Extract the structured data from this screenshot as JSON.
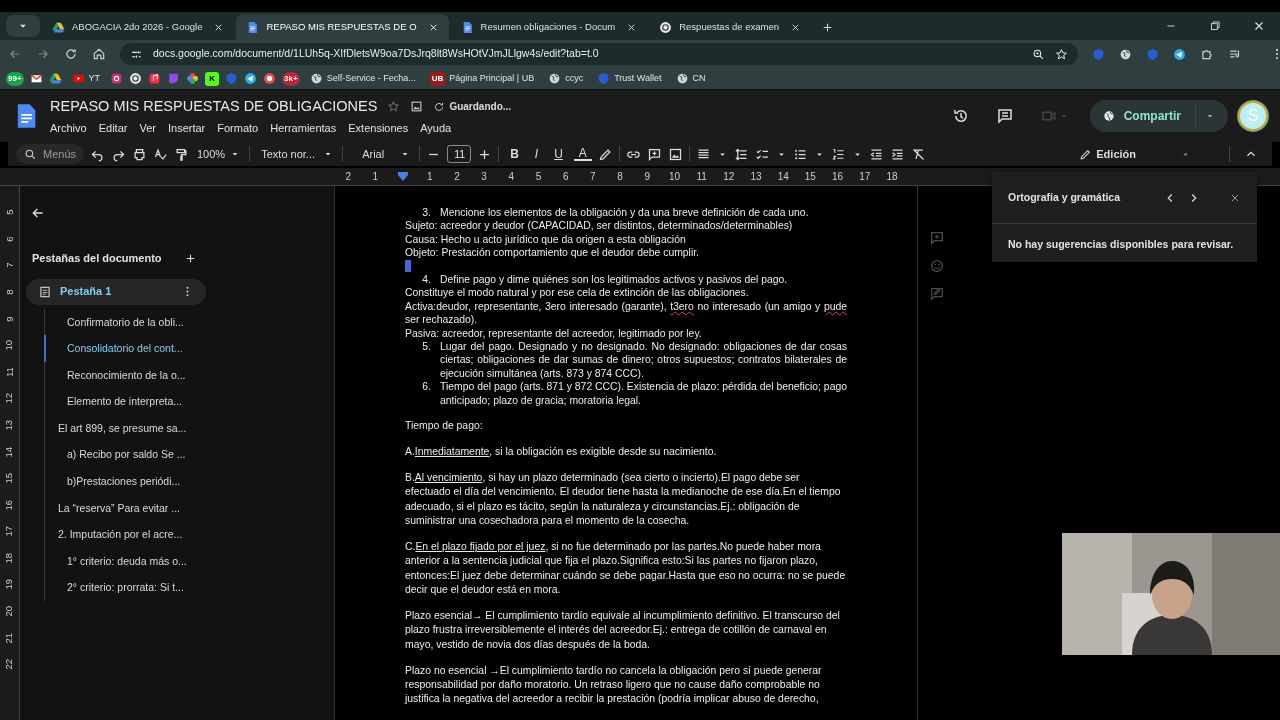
{
  "browser": {
    "tabs": [
      {
        "title": "ABOGACIA 2do 2026 - Google",
        "kind": "drive",
        "selected": false
      },
      {
        "title": "REPASO MIS RESPUESTAS DE O",
        "kind": "docs",
        "selected": true
      },
      {
        "title": "Resumen obligaciones - Docum",
        "kind": "docs",
        "selected": false
      },
      {
        "title": "Respuestas de examen",
        "kind": "chat",
        "selected": false
      }
    ],
    "url": "docs.google.com/document/d/1LUh5q-XIfDletsW9oa7DsJrq8lt8WsHOtVJmJLlgw4s/edit?tab=t.0",
    "bookmarks": [
      {
        "kind": "whatsapp",
        "badge": "99+"
      },
      {
        "kind": "mail"
      },
      {
        "kind": "drive"
      },
      {
        "kind": "youtube",
        "label": "YT"
      },
      {
        "kind": "camera"
      },
      {
        "kind": "chat"
      },
      {
        "kind": "music"
      },
      {
        "kind": "stream"
      },
      {
        "kind": "photos"
      },
      {
        "kind": "kick",
        "icon_text": "K"
      },
      {
        "kind": "shield"
      },
      {
        "kind": "send"
      },
      {
        "kind": "game"
      },
      {
        "kind": "counter",
        "icon_text": "3k+"
      },
      {
        "kind": "web",
        "label": "Self-Service - Fecha..."
      },
      {
        "kind": "ub",
        "icon_text": "UB",
        "label": "Página Principal | UB"
      },
      {
        "kind": "web",
        "label": "ccyc"
      },
      {
        "kind": "shield",
        "label": "Trust Wallet"
      },
      {
        "kind": "web",
        "label": "CN"
      }
    ]
  },
  "docs": {
    "title": "REPASO MIS RESPUESTAS DE OBLIGACIONES",
    "status": "Guardando...",
    "menus": [
      "Archivo",
      "Editar",
      "Ver",
      "Insertar",
      "Formato",
      "Herramientas",
      "Extensiones",
      "Ayuda"
    ],
    "share": "Compartir",
    "avatar_letter": "S",
    "toolbar": {
      "search_placeholder": "Menús",
      "zoom": "100%",
      "style": "Texto nor...",
      "font": "Arial",
      "size": "11",
      "format_buttons": [
        "B",
        "I",
        "U",
        "A"
      ],
      "mode": "Edición"
    },
    "ruler": [
      {
        "label": "2"
      },
      {
        "label": "1"
      },
      {
        "kind": "indent_marker"
      },
      {
        "label": "1"
      },
      {
        "label": "2"
      },
      {
        "label": "3"
      },
      {
        "label": "4"
      },
      {
        "label": "5"
      },
      {
        "label": "6"
      },
      {
        "label": "7"
      },
      {
        "label": "8"
      },
      {
        "label": "9"
      },
      {
        "label": "10"
      },
      {
        "label": "11"
      },
      {
        "label": "12"
      },
      {
        "label": "13"
      },
      {
        "label": "14"
      },
      {
        "label": "15"
      },
      {
        "label": "16"
      },
      {
        "label": "17"
      },
      {
        "label": "18"
      }
    ],
    "vertical_ruler": [
      "5",
      "6",
      "7",
      "8",
      "9",
      "10",
      "11",
      "12",
      "13",
      "14",
      "15",
      "16",
      "17",
      "18",
      "19",
      "20",
      "21",
      "22"
    ]
  },
  "sidebar": {
    "heading": "Pestañas del documento",
    "tab": {
      "label": "Pestaña 1",
      "selected": true
    },
    "outline": [
      {
        "children": [
          {
            "label": "Confirmatorio de la obli...",
            "selected": false
          },
          {
            "label": "Consolidatorio del cont...",
            "selected": true
          },
          {
            "label": "Reconocimiento de la o...",
            "selected": false
          },
          {
            "label": "Elemento de interpreta...",
            "selected": false
          }
        ]
      },
      {
        "label": "El art 899, se presume sa...",
        "selected": false,
        "children": [
          {
            "label": "a) Recibo por saldo Se ...",
            "selected": false
          },
          {
            "label": "b)Prestaciones periódi...",
            "selected": false
          }
        ]
      },
      {
        "label": "La “reserva” Para evitar ...",
        "selected": false
      },
      {
        "label": "2. Imputación por el acre...",
        "selected": false,
        "children": [
          {
            "label": "1° criterio: deuda más o...",
            "selected": false
          },
          {
            "label": "2° criterio: prorrata: Si t...",
            "selected": false
          }
        ]
      }
    ]
  },
  "document": [
    {
      "kind": "numbered",
      "number": "3.",
      "parts": [
        {
          "text": "Mencione los elementos de la obligación y da una breve definición de cada uno."
        }
      ]
    },
    {
      "kind": "line",
      "parts": [
        {
          "text": "Sujeto: acreedor y deudor  (CAPACIDAD, ser distintos, determinados/determinables)"
        }
      ]
    },
    {
      "kind": "line",
      "parts": [
        {
          "text": "Causa: Hecho u acto jurídico que da origen a esta obligación"
        }
      ]
    },
    {
      "kind": "line",
      "parts": [
        {
          "text": "Objeto: Prestación comportamiento que el deudor debe cumplir."
        }
      ]
    },
    {
      "kind": "cursor"
    },
    {
      "kind": "numbered",
      "number": "4.",
      "parts": [
        {
          "text": "Define pago y dime quiénes son los legitimados activos y pasivos del pago."
        }
      ]
    },
    {
      "kind": "line",
      "parts": [
        {
          "text": "Constituye el modo natural y por ese cela de extinción de las obligaciones."
        }
      ]
    },
    {
      "kind": "line",
      "justified": true,
      "parts": [
        {
          "text": "Activa:deudor, representante, 3ero interesado (garante), "
        },
        {
          "text": "t3ero",
          "misspelled": true
        },
        {
          "text": " no interesado (un amigo y "
        },
        {
          "text": "pude",
          "misspelled": true
        },
        {
          "text": " ser rechazado)."
        }
      ]
    },
    {
      "kind": "line",
      "parts": [
        {
          "text": "Pasiva: acreedor, representante del acreedor, legitimado por ley."
        }
      ]
    },
    {
      "kind": "numbered",
      "number": "5.",
      "justified": true,
      "parts": [
        {
          "text": "Lugar del pago. Designado y no designado. No designado: obligaciones de dar cosas ciertas; obligaciones de dar sumas de dinero; otros supuestos; contratos bilaterales de ejecución simultánea (arts. 873 y 874 CCC)."
        }
      ]
    },
    {
      "kind": "numbered",
      "number": "6.",
      "justified": true,
      "parts": [
        {
          "text": "Tiempo del pago (arts. 871 y 872 CCC). Existencia de plazo: pérdida del beneficio; pago anticipado; plazo de gracia; moratoria legal."
        }
      ]
    },
    {
      "kind": "para",
      "parts": [
        {
          "text": "Tiempo de pago:"
        }
      ]
    },
    {
      "kind": "para",
      "parts": [
        {
          "text": "A."
        },
        {
          "text": "Inmediatamente",
          "underline": true
        },
        {
          "text": ", si la obligación es exigible desde su nacimiento."
        }
      ]
    },
    {
      "kind": "para",
      "parts": [
        {
          "text": "B."
        },
        {
          "text": "Al vencimiento",
          "underline": true
        },
        {
          "text": ", si hay un plazo determinado (sea cierto o incierto).El pago debe ser efectuado el día del vencimiento. El deudor tiene hasta la medianoche de ese día.En el tiempo adecuado, si el plazo es tácito, según la naturaleza y circunstancias.Ej.: obligación de suministrar una cosechadora para el momento de la cosecha."
        }
      ]
    },
    {
      "kind": "para",
      "parts": [
        {
          "text": "C."
        },
        {
          "text": "En el plazo fijado por el juez",
          "underline": true
        },
        {
          "text": ", si no fue determinado por las partes.No puede haber mora anterior a la sentencia judicial que fija el plazo.Significa esto:Si las partes no fijaron plazo, entonces:El juez debe determinar cuándo se debe pagar.Hasta que eso no ocurra: no se puede decir que el deudor está en mora."
        }
      ]
    },
    {
      "kind": "para",
      "parts": [
        {
          "text": "Plazo esencial→ El cumplimiento tardío equivale al incumplimiento definitivo. El transcurso del plazo frustra irreversiblemente el interés del acreedor.Ej.: entrega de cotillón de carnaval en mayo, vestido de novia dos días después de la boda."
        }
      ]
    },
    {
      "kind": "para",
      "parts": [
        {
          "text": "Plazo no esencial →El cumplimiento tardío no cancela la obligación pero sí puede generar responsabilidad por daño moratorio. Un retraso ligero que no cause daño comprobable no justifica la negativa del acreedor a recibir la prestación (podría implicar abuso de derecho,"
        }
      ]
    }
  ],
  "spelling_panel": {
    "title": "Ortografía y gramática",
    "message": "No hay sugerencias disponibles para revisar."
  }
}
